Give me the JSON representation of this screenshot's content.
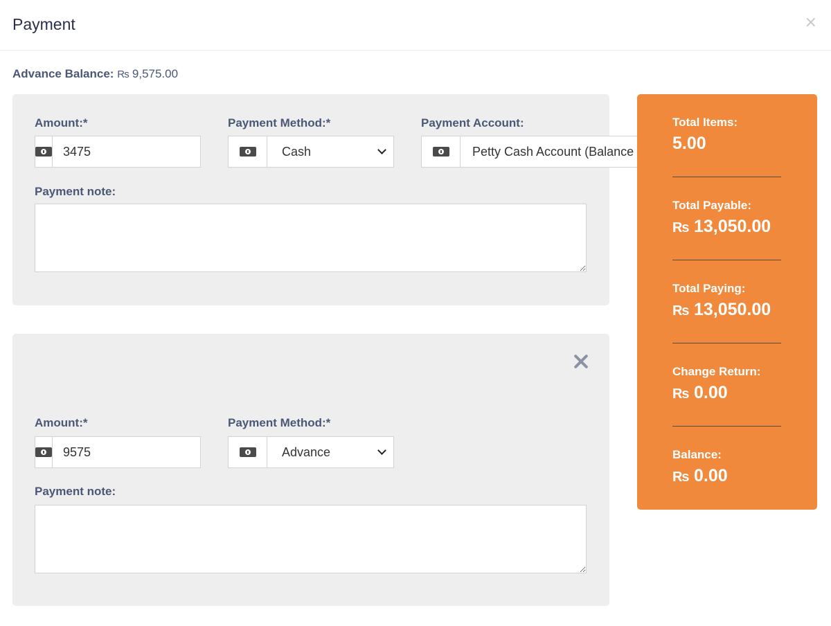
{
  "modal": {
    "title": "Payment",
    "close_symbol": "×"
  },
  "advance": {
    "label": "Advance Balance:",
    "currency": "₨",
    "value": "9,575.00"
  },
  "payments": [
    {
      "amount_label": "Amount:*",
      "amount_value": "3475",
      "method_label": "Payment Method:*",
      "method_value": "Cash",
      "account_label": "Payment Account:",
      "account_value": "Petty Cash Account (Balance",
      "note_label": "Payment note:",
      "note_value": ""
    },
    {
      "amount_label": "Amount:*",
      "amount_value": "9575",
      "method_label": "Payment Method:*",
      "method_value": "Advance",
      "note_label": "Payment note:",
      "note_value": ""
    }
  ],
  "summary": {
    "currency": "₨",
    "total_items_label": "Total Items:",
    "total_items_value": "5.00",
    "total_payable_label": "Total Payable:",
    "total_payable_value": "13,050.00",
    "total_paying_label": "Total Paying:",
    "total_paying_value": "13,050.00",
    "change_return_label": "Change Return:",
    "change_return_value": "0.00",
    "balance_label": "Balance:",
    "balance_value": "0.00"
  },
  "icons": {
    "addon": "money-bill-icon",
    "remove": "close-icon"
  },
  "colors": {
    "summary_bg": "#f0893b",
    "panel_bg": "#efeeef",
    "label": "#4a5876"
  }
}
